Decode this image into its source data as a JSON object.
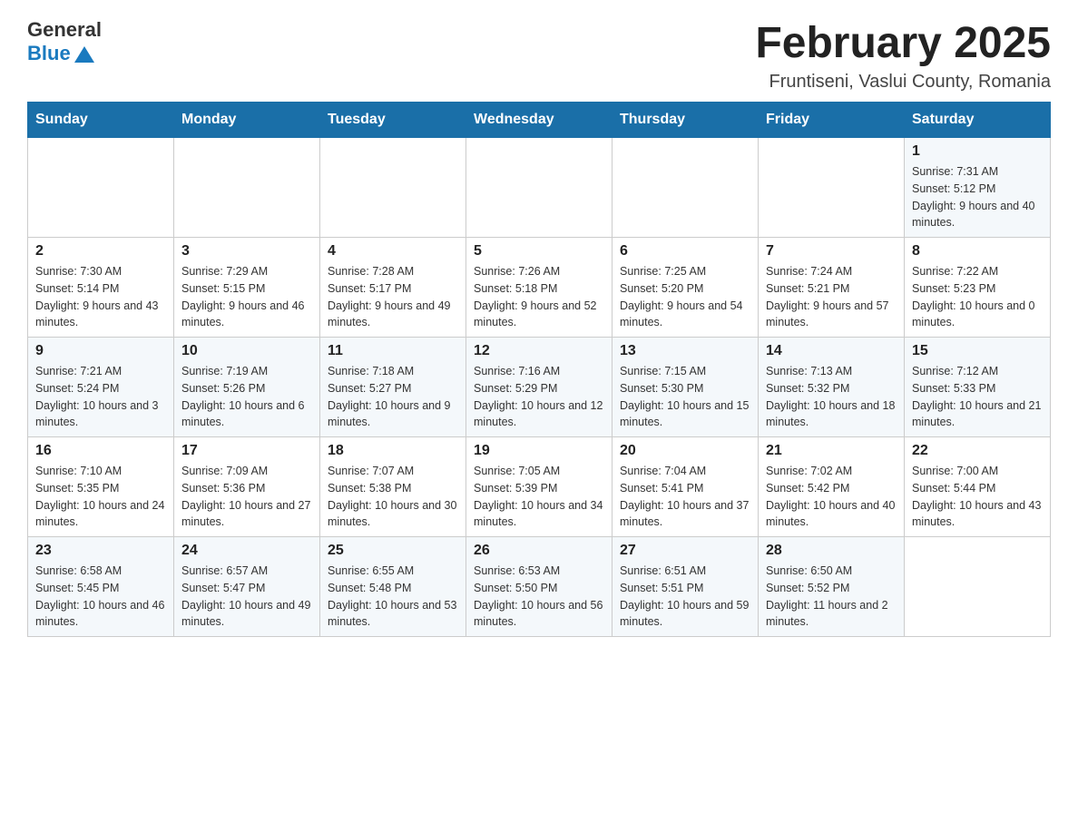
{
  "header": {
    "logo": {
      "text_general": "General",
      "text_blue": "Blue"
    },
    "title": "February 2025",
    "subtitle": "Fruntiseni, Vaslui County, Romania"
  },
  "calendar": {
    "headers": [
      "Sunday",
      "Monday",
      "Tuesday",
      "Wednesday",
      "Thursday",
      "Friday",
      "Saturday"
    ],
    "weeks": [
      {
        "days": [
          {
            "number": "",
            "info": ""
          },
          {
            "number": "",
            "info": ""
          },
          {
            "number": "",
            "info": ""
          },
          {
            "number": "",
            "info": ""
          },
          {
            "number": "",
            "info": ""
          },
          {
            "number": "",
            "info": ""
          },
          {
            "number": "1",
            "info": "Sunrise: 7:31 AM\nSunset: 5:12 PM\nDaylight: 9 hours and 40 minutes."
          }
        ]
      },
      {
        "days": [
          {
            "number": "2",
            "info": "Sunrise: 7:30 AM\nSunset: 5:14 PM\nDaylight: 9 hours and 43 minutes."
          },
          {
            "number": "3",
            "info": "Sunrise: 7:29 AM\nSunset: 5:15 PM\nDaylight: 9 hours and 46 minutes."
          },
          {
            "number": "4",
            "info": "Sunrise: 7:28 AM\nSunset: 5:17 PM\nDaylight: 9 hours and 49 minutes."
          },
          {
            "number": "5",
            "info": "Sunrise: 7:26 AM\nSunset: 5:18 PM\nDaylight: 9 hours and 52 minutes."
          },
          {
            "number": "6",
            "info": "Sunrise: 7:25 AM\nSunset: 5:20 PM\nDaylight: 9 hours and 54 minutes."
          },
          {
            "number": "7",
            "info": "Sunrise: 7:24 AM\nSunset: 5:21 PM\nDaylight: 9 hours and 57 minutes."
          },
          {
            "number": "8",
            "info": "Sunrise: 7:22 AM\nSunset: 5:23 PM\nDaylight: 10 hours and 0 minutes."
          }
        ]
      },
      {
        "days": [
          {
            "number": "9",
            "info": "Sunrise: 7:21 AM\nSunset: 5:24 PM\nDaylight: 10 hours and 3 minutes."
          },
          {
            "number": "10",
            "info": "Sunrise: 7:19 AM\nSunset: 5:26 PM\nDaylight: 10 hours and 6 minutes."
          },
          {
            "number": "11",
            "info": "Sunrise: 7:18 AM\nSunset: 5:27 PM\nDaylight: 10 hours and 9 minutes."
          },
          {
            "number": "12",
            "info": "Sunrise: 7:16 AM\nSunset: 5:29 PM\nDaylight: 10 hours and 12 minutes."
          },
          {
            "number": "13",
            "info": "Sunrise: 7:15 AM\nSunset: 5:30 PM\nDaylight: 10 hours and 15 minutes."
          },
          {
            "number": "14",
            "info": "Sunrise: 7:13 AM\nSunset: 5:32 PM\nDaylight: 10 hours and 18 minutes."
          },
          {
            "number": "15",
            "info": "Sunrise: 7:12 AM\nSunset: 5:33 PM\nDaylight: 10 hours and 21 minutes."
          }
        ]
      },
      {
        "days": [
          {
            "number": "16",
            "info": "Sunrise: 7:10 AM\nSunset: 5:35 PM\nDaylight: 10 hours and 24 minutes."
          },
          {
            "number": "17",
            "info": "Sunrise: 7:09 AM\nSunset: 5:36 PM\nDaylight: 10 hours and 27 minutes."
          },
          {
            "number": "18",
            "info": "Sunrise: 7:07 AM\nSunset: 5:38 PM\nDaylight: 10 hours and 30 minutes."
          },
          {
            "number": "19",
            "info": "Sunrise: 7:05 AM\nSunset: 5:39 PM\nDaylight: 10 hours and 34 minutes."
          },
          {
            "number": "20",
            "info": "Sunrise: 7:04 AM\nSunset: 5:41 PM\nDaylight: 10 hours and 37 minutes."
          },
          {
            "number": "21",
            "info": "Sunrise: 7:02 AM\nSunset: 5:42 PM\nDaylight: 10 hours and 40 minutes."
          },
          {
            "number": "22",
            "info": "Sunrise: 7:00 AM\nSunset: 5:44 PM\nDaylight: 10 hours and 43 minutes."
          }
        ]
      },
      {
        "days": [
          {
            "number": "23",
            "info": "Sunrise: 6:58 AM\nSunset: 5:45 PM\nDaylight: 10 hours and 46 minutes."
          },
          {
            "number": "24",
            "info": "Sunrise: 6:57 AM\nSunset: 5:47 PM\nDaylight: 10 hours and 49 minutes."
          },
          {
            "number": "25",
            "info": "Sunrise: 6:55 AM\nSunset: 5:48 PM\nDaylight: 10 hours and 53 minutes."
          },
          {
            "number": "26",
            "info": "Sunrise: 6:53 AM\nSunset: 5:50 PM\nDaylight: 10 hours and 56 minutes."
          },
          {
            "number": "27",
            "info": "Sunrise: 6:51 AM\nSunset: 5:51 PM\nDaylight: 10 hours and 59 minutes."
          },
          {
            "number": "28",
            "info": "Sunrise: 6:50 AM\nSunset: 5:52 PM\nDaylight: 11 hours and 2 minutes."
          },
          {
            "number": "",
            "info": ""
          }
        ]
      }
    ]
  }
}
